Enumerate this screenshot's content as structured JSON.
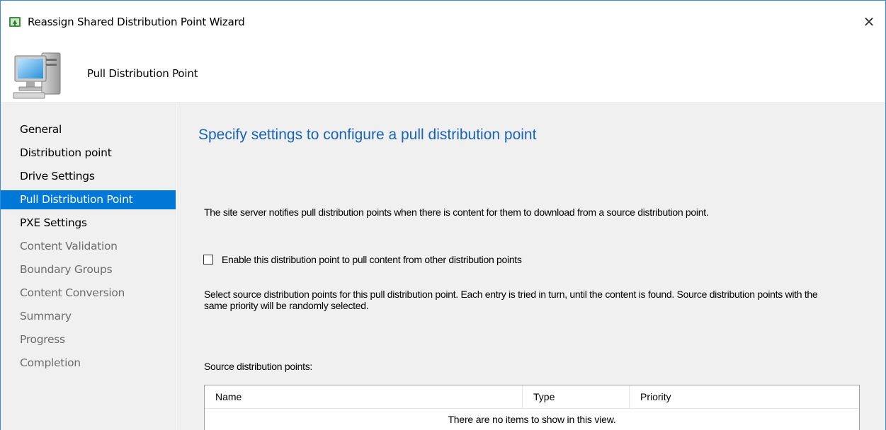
{
  "window": {
    "title": "Reassign Shared Distribution Point Wizard",
    "close_glyph": "×"
  },
  "header": {
    "title": "Pull Distribution Point",
    "icon": "computer-icon"
  },
  "nav": {
    "items": [
      {
        "label": "General",
        "state": "done"
      },
      {
        "label": "Distribution point",
        "state": "done"
      },
      {
        "label": "Drive Settings",
        "state": "done"
      },
      {
        "label": "Pull Distribution Point",
        "state": "active"
      },
      {
        "label": "PXE Settings",
        "state": "done"
      },
      {
        "label": "Content Validation",
        "state": "pending"
      },
      {
        "label": "Boundary Groups",
        "state": "pending"
      },
      {
        "label": "Content Conversion",
        "state": "pending"
      },
      {
        "label": "Summary",
        "state": "pending"
      },
      {
        "label": "Progress",
        "state": "pending"
      },
      {
        "label": "Completion",
        "state": "pending"
      }
    ]
  },
  "main": {
    "heading": "Specify settings to configure a pull distribution point",
    "description": "The site server notifies pull distribution points when there is content for them to download from a source distribution point.",
    "enable_checkbox": {
      "label": "Enable this distribution point to pull content from other distribution points",
      "checked": false
    },
    "info": "Select source distribution points for this pull distribution point. Each entry is tried in turn, until the content is found. Source distribution points with the same priority will be randomly selected.",
    "source_label": "Source distribution points:",
    "list": {
      "columns": [
        "Name",
        "Type",
        "Priority"
      ],
      "empty_message": "There are no items to show in this view."
    }
  },
  "colors": {
    "accent": "#0078d7",
    "heading": "#1a63b8",
    "window_border": "#3b8ad8"
  }
}
